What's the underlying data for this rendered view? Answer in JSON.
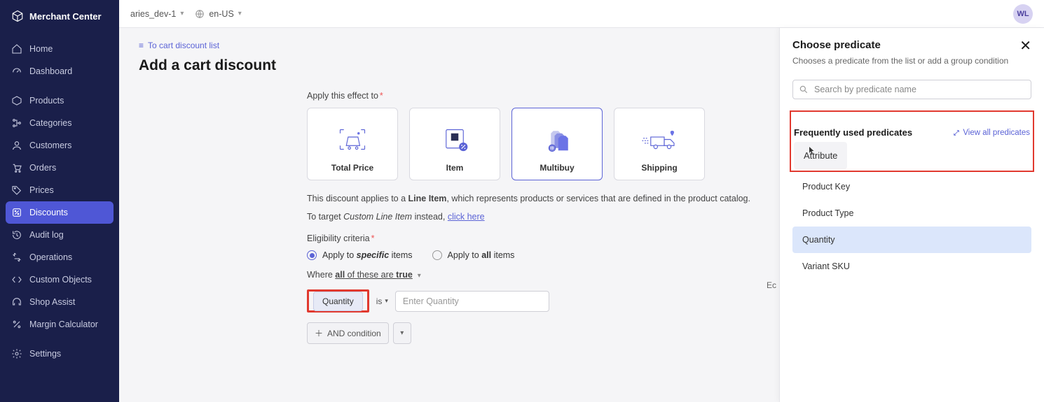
{
  "brand": "Merchant Center",
  "topbar": {
    "project": "aries_dev-1",
    "locale": "en-US",
    "avatar": "WL"
  },
  "sidebar": {
    "items": [
      {
        "label": "Home"
      },
      {
        "label": "Dashboard"
      },
      {
        "label": "Products"
      },
      {
        "label": "Categories"
      },
      {
        "label": "Customers"
      },
      {
        "label": "Orders"
      },
      {
        "label": "Prices"
      },
      {
        "label": "Discounts"
      },
      {
        "label": "Audit log"
      },
      {
        "label": "Operations"
      },
      {
        "label": "Custom Objects"
      },
      {
        "label": "Shop Assist"
      },
      {
        "label": "Margin Calculator"
      },
      {
        "label": "Settings"
      }
    ]
  },
  "breadcrumb": "To cart discount list",
  "page_title": "Add a cart discount",
  "apply_label": "Apply this effect to",
  "effects": {
    "total_price": "Total Price",
    "item": "Item",
    "multibuy": "Multibuy",
    "shipping": "Shipping"
  },
  "body": {
    "line1_prefix": "This discount applies to a ",
    "line1_bold": "Line Item",
    "line1_suffix": ", which represents products or services that are defined in the product catalog.",
    "line2_prefix": "To target ",
    "line2_italic": "Custom Line Item",
    "line2_mid": " instead, ",
    "line2_link": "click here"
  },
  "criteria_label": "Eligibility criteria",
  "radio": {
    "specific_pre": "Apply to ",
    "specific_b": "specific",
    "specific_post": " items",
    "all_pre": "Apply to ",
    "all_b": "all",
    "all_post": " items"
  },
  "where": {
    "pre": "Where ",
    "mid1": "all",
    "mid2": " of these are ",
    "mid3": "true"
  },
  "condition": {
    "field": "Quantity",
    "op": "is",
    "placeholder": "Enter Quantity"
  },
  "and_btn": "AND condition",
  "panel": {
    "title": "Choose predicate",
    "subtitle": "Chooses a predicate from the list or add a group condition",
    "search_placeholder": "Search by predicate name",
    "freq_title": "Frequently used predicates",
    "view_all": "View all predicates",
    "items": {
      "attribute": "Attribute",
      "product_key": "Product Key",
      "product_type": "Product Type",
      "quantity": "Quantity",
      "variant_sku": "Variant SKU"
    }
  },
  "cut_text": "Ec"
}
